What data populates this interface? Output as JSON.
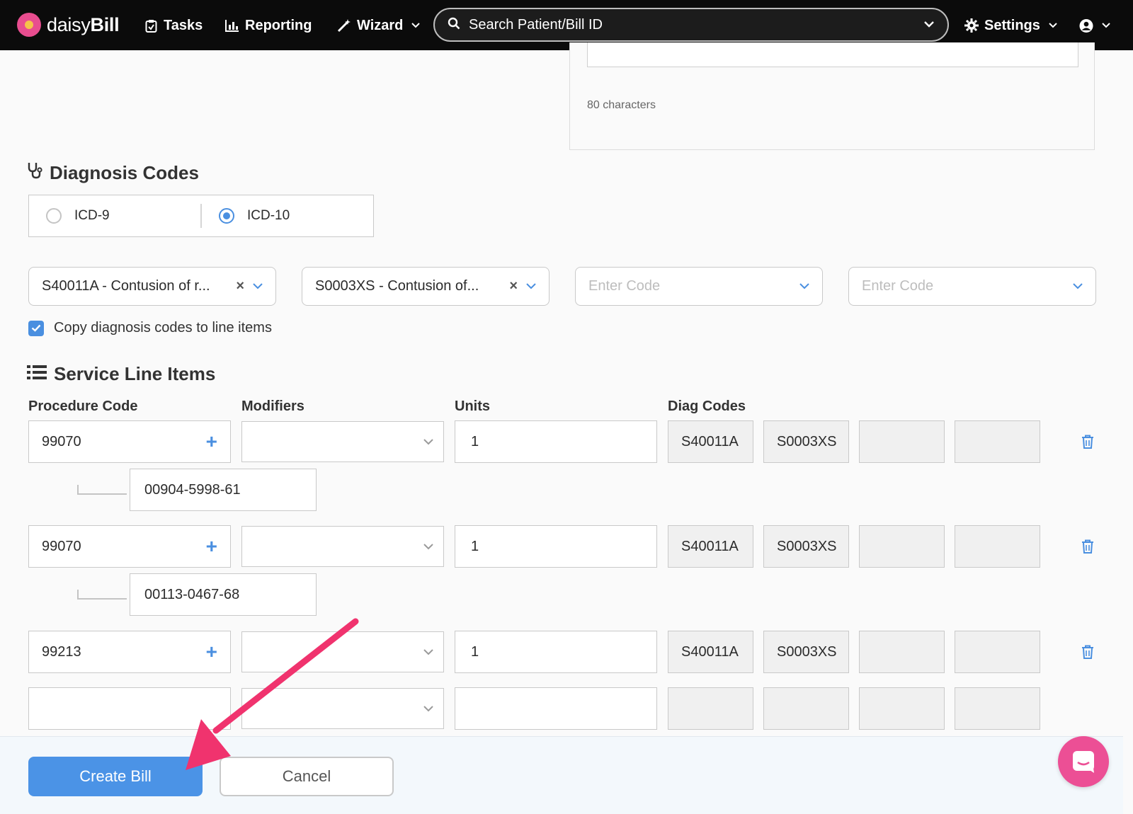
{
  "nav": {
    "brand_light": "daisy",
    "brand_bold": "Bill",
    "tasks": "Tasks",
    "reporting": "Reporting",
    "wizard": "Wizard",
    "search_placeholder": "Search Patient/Bill ID",
    "settings": "Settings"
  },
  "form_top": {
    "char_count": "80 characters"
  },
  "diagnosis": {
    "title": "Diagnosis Codes",
    "code_set_options": [
      "ICD-9",
      "ICD-10"
    ],
    "selected_code_set": "ICD-10",
    "codes": [
      {
        "value": "S40011A - Contusion of r...",
        "placeholder": ""
      },
      {
        "value": "S0003XS - Contusion of...",
        "placeholder": ""
      },
      {
        "value": "",
        "placeholder": "Enter Code"
      },
      {
        "value": "",
        "placeholder": "Enter Code"
      }
    ],
    "copy_label": "Copy diagnosis codes to line items",
    "copy_checked": true
  },
  "service": {
    "title": "Service Line Items",
    "headers": [
      "Procedure Code",
      "Modifiers",
      "Units",
      "Diag Codes"
    ],
    "rows": [
      {
        "procedure": "99070",
        "modifier": "",
        "units": "1",
        "diag": [
          "S40011A",
          "S0003XS",
          "",
          ""
        ],
        "ndc": "00904-5998-61"
      },
      {
        "procedure": "99070",
        "modifier": "",
        "units": "1",
        "diag": [
          "S40011A",
          "S0003XS",
          "",
          ""
        ],
        "ndc": "00113-0467-68"
      },
      {
        "procedure": "99213",
        "modifier": "",
        "units": "1",
        "diag": [
          "S40011A",
          "S0003XS",
          "",
          ""
        ],
        "ndc": ""
      },
      {
        "procedure": "",
        "modifier": "",
        "units": "",
        "diag": [
          "",
          "",
          "",
          ""
        ],
        "ndc": ""
      }
    ]
  },
  "footer": {
    "create_label": "Create Bill",
    "cancel_label": "Cancel"
  },
  "colors": {
    "accent": "#4b93e6",
    "annotation_arrow": "#f0336e",
    "chat_button": "#ec4f95"
  },
  "icons": [
    "tasks-icon",
    "reporting-icon",
    "wizard-icon",
    "search-icon",
    "gear-icon",
    "user-icon",
    "stethoscope-icon",
    "list-icon",
    "trash-icon",
    "chat-icon"
  ]
}
